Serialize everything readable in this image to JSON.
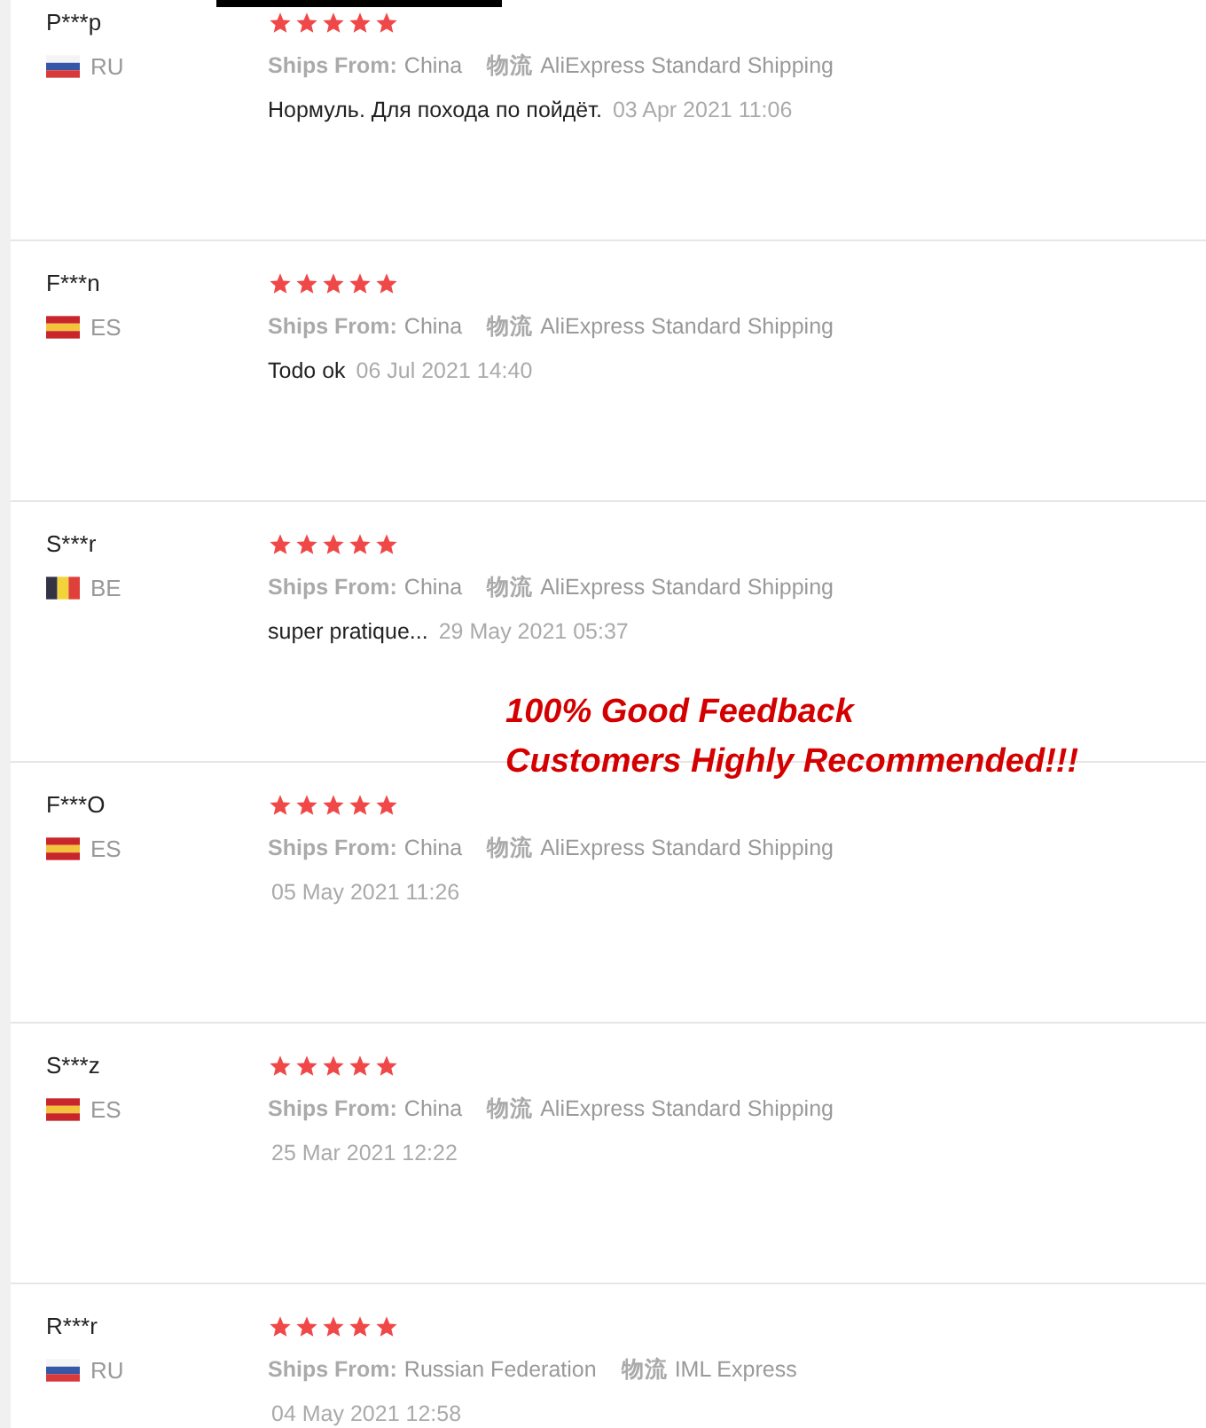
{
  "reviews": [
    {
      "name": "P***p",
      "country": "RU",
      "stars": 5,
      "ships_from_label": "Ships From:",
      "ships_from": "China",
      "logistics_label": "物流",
      "logistics": "AliExpress Standard Shipping",
      "feedback": "Нормуль. Для похода по пойдёт.",
      "date": "03 Apr 2021 11:06"
    },
    {
      "name": "F***n",
      "country": "ES",
      "stars": 5,
      "ships_from_label": "Ships From:",
      "ships_from": "China",
      "logistics_label": "物流",
      "logistics": "AliExpress Standard Shipping",
      "feedback": "Todo ok",
      "date": "06 Jul 2021 14:40"
    },
    {
      "name": "S***r",
      "country": "BE",
      "stars": 5,
      "ships_from_label": "Ships From:",
      "ships_from": "China",
      "logistics_label": "物流",
      "logistics": "AliExpress Standard Shipping",
      "feedback": "super pratique...",
      "date": "29 May 2021 05:37"
    },
    {
      "name": "F***O",
      "country": "ES",
      "stars": 5,
      "ships_from_label": "Ships From:",
      "ships_from": "China",
      "logistics_label": "物流",
      "logistics": "AliExpress Standard Shipping",
      "date": "05 May 2021 11:26"
    },
    {
      "name": "S***z",
      "country": "ES",
      "stars": 5,
      "ships_from_label": "Ships From:",
      "ships_from": "China",
      "logistics_label": "物流",
      "logistics": "AliExpress Standard Shipping",
      "date": "25 Mar 2021 12:22"
    },
    {
      "name": "R***r",
      "country": "RU",
      "stars": 5,
      "ships_from_label": "Ships From:",
      "ships_from": "Russian Federation",
      "logistics_label": "物流",
      "logistics": "IML Express",
      "date": "04 May 2021 12:58"
    }
  ],
  "promo": [
    "100% Good Feedback",
    "Customers Highly Recommended!!!"
  ]
}
